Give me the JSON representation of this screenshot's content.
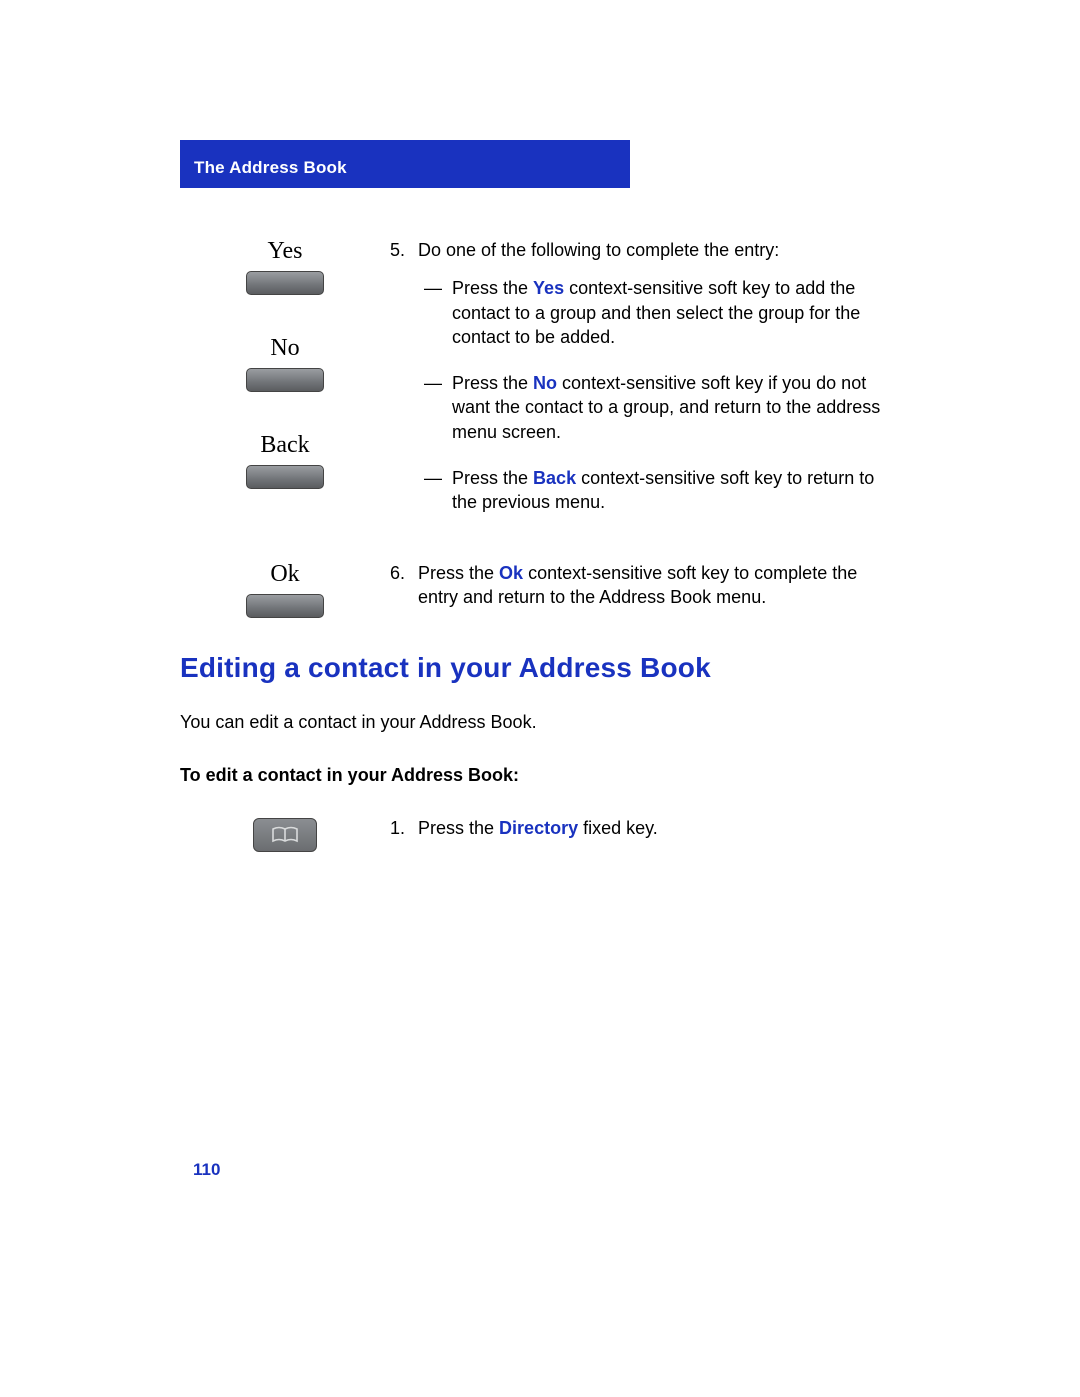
{
  "header": {
    "title": "The Address Book"
  },
  "softkeys": {
    "yes": "Yes",
    "no": "No",
    "back": "Back",
    "ok": "Ok"
  },
  "step5": {
    "number": "5.",
    "lead": "Do one of the following to complete the entry:",
    "yes_item": {
      "dash": "—",
      "pre": "Press the ",
      "bold": "Yes",
      "post": " context-sensitive soft key to add the contact to a group and then select the group for the contact to be added."
    },
    "no_item": {
      "dash": "—",
      "pre": "Press the ",
      "bold": "No",
      "post": " context-sensitive soft key if you do not want the contact to a group, and return to the address menu screen."
    },
    "back_item": {
      "dash": "—",
      "pre": "Press the ",
      "bold": "Back",
      "post": " context-sensitive soft key to return to the previous menu."
    }
  },
  "step6": {
    "number": "6.",
    "pre": "Press the ",
    "bold": "Ok",
    "post": " context-sensitive soft key to complete the entry and return to the Address Book menu."
  },
  "section": {
    "heading": "Editing a contact in your Address Book",
    "intro": "You can edit a contact in your Address Book.",
    "subhead": "To edit a contact in your Address Book:"
  },
  "step1": {
    "number": "1.",
    "pre": "Press the ",
    "bold": "Directory",
    "post": " fixed key."
  },
  "page_number": "110"
}
